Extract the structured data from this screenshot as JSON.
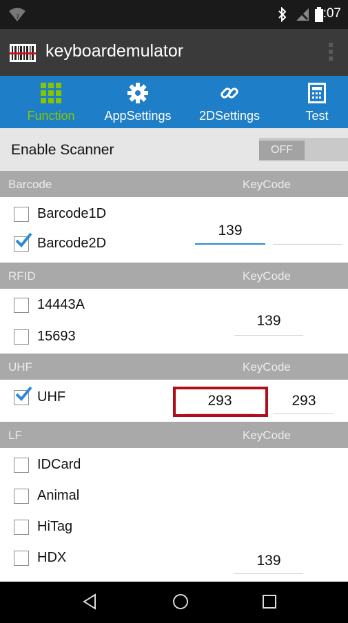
{
  "status_bar": {
    "time": "1:07",
    "icons": [
      "wifi-icon",
      "bluetooth-icon",
      "no-signal-icon",
      "battery-icon"
    ]
  },
  "app": {
    "title": "keyboardemulator"
  },
  "tabs": [
    {
      "label": "Function",
      "icon": "grid-icon",
      "active": true
    },
    {
      "label": "AppSettings",
      "icon": "gear-icon",
      "active": false
    },
    {
      "label": "2DSettings",
      "icon": "link-icon",
      "active": false
    },
    {
      "label": "Test",
      "icon": "calculator-icon",
      "active": false
    }
  ],
  "enable_scanner": {
    "label": "Enable Scanner",
    "toggle": "OFF"
  },
  "sections": {
    "barcode": {
      "title": "Barcode",
      "keycode_header": "KeyCode",
      "items": [
        {
          "label": "Barcode1D",
          "checked": false
        },
        {
          "label": "Barcode2D",
          "checked": true
        }
      ],
      "keycode_value": "139",
      "keycode_value2": ""
    },
    "rfid": {
      "title": "RFID",
      "keycode_header": "KeyCode",
      "items": [
        {
          "label": "14443A",
          "checked": false
        },
        {
          "label": "15693",
          "checked": false
        }
      ],
      "keycode_value": "139"
    },
    "uhf": {
      "title": "UHF",
      "keycode_header": "KeyCode",
      "items": [
        {
          "label": "UHF",
          "checked": true
        }
      ],
      "keycode_value": "293",
      "keycode_value2": "293"
    },
    "lf": {
      "title": "LF",
      "keycode_header": "KeyCode",
      "items": [
        {
          "label": "IDCard",
          "checked": false
        },
        {
          "label": "Animal",
          "checked": false
        },
        {
          "label": "HiTag",
          "checked": false
        },
        {
          "label": "HDX",
          "checked": false
        }
      ],
      "keycode_value": "139"
    }
  },
  "colors": {
    "tab_bar": "#1e7ec8",
    "active_tab": "#85c600",
    "checkbox_check": "#2a8ad8",
    "highlight": "#b00d1a",
    "section_header": "#a9a9a9"
  }
}
